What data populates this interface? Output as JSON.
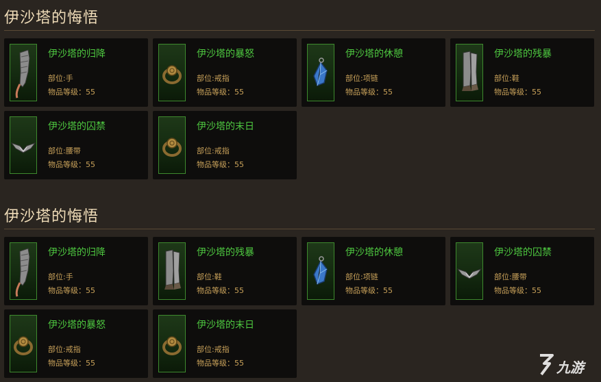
{
  "sections": [
    {
      "title": "伊沙塔的悔悟",
      "items": [
        {
          "name": "伊沙塔的归降",
          "slot": "部位:手",
          "level": "物品等级：55",
          "icon": "gauntlet-icon"
        },
        {
          "name": "伊沙塔的暴怒",
          "slot": "部位:戒指",
          "level": "物品等级：55",
          "icon": "ring-icon"
        },
        {
          "name": "伊沙塔的休憩",
          "slot": "部位:项链",
          "level": "物品等级：55",
          "icon": "amulet-icon"
        },
        {
          "name": "伊沙塔的残暴",
          "slot": "部位:鞋",
          "level": "物品等级：55",
          "icon": "boots-icon"
        },
        {
          "name": "伊沙塔的囚禁",
          "slot": "部位:腰带",
          "level": "物品等级：55",
          "icon": "belt-icon"
        },
        {
          "name": "伊沙塔的末日",
          "slot": "部位:戒指",
          "level": "物品等级：55",
          "icon": "ring-icon"
        }
      ]
    },
    {
      "title": "伊沙塔的悔悟",
      "items": [
        {
          "name": "伊沙塔的归降",
          "slot": "部位:手",
          "level": "物品等级：55",
          "icon": "gauntlet-icon"
        },
        {
          "name": "伊沙塔的残暴",
          "slot": "部位:鞋",
          "level": "物品等级：55",
          "icon": "boots-icon"
        },
        {
          "name": "伊沙塔的休憩",
          "slot": "部位:项链",
          "level": "物品等级：55",
          "icon": "amulet-icon"
        },
        {
          "name": "伊沙塔的囚禁",
          "slot": "部位:腰带",
          "level": "物品等级：55",
          "icon": "belt-icon"
        },
        {
          "name": "伊沙塔的暴怒",
          "slot": "部位:戒指",
          "level": "物品等级：55",
          "icon": "ring-icon"
        },
        {
          "name": "伊沙塔的末日",
          "slot": "部位:戒指",
          "level": "物品等级：55",
          "icon": "ring-icon"
        }
      ]
    }
  ],
  "watermark": {
    "text": "九游",
    "icon": "jiuyou-logo-icon"
  },
  "colors": {
    "background": "#2a2520",
    "card": "#0e0d0c",
    "item_name": "#4ec940",
    "item_meta": "#c9a25a",
    "section_title": "#efdcb8",
    "frame_border": "#3e8a2e"
  }
}
